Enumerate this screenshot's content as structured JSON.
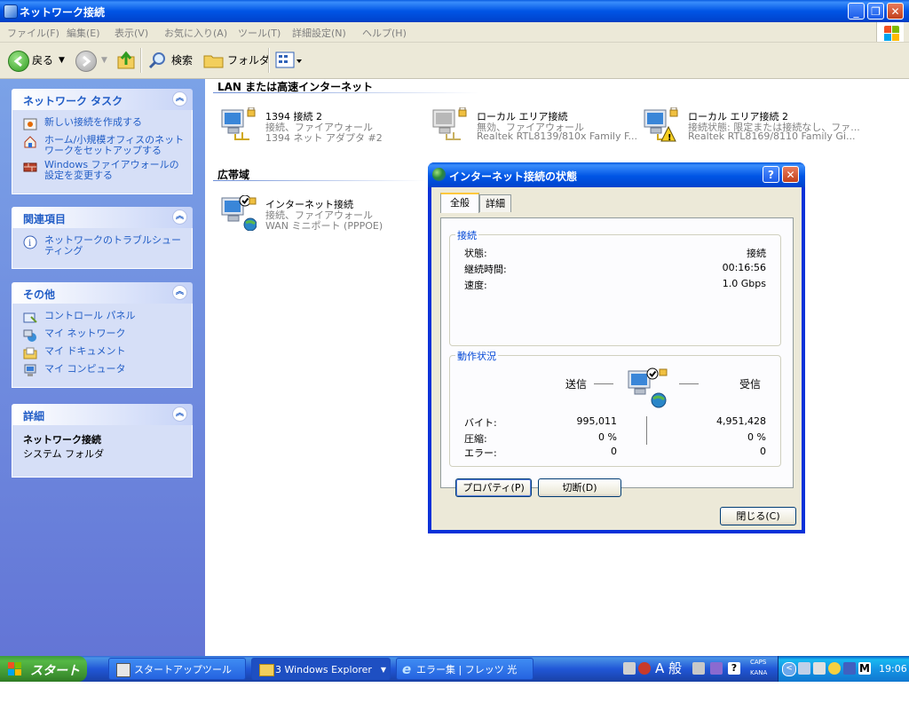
{
  "window": {
    "title": "ネットワーク接続"
  },
  "menu": [
    "ファイル(F)",
    "編集(E)",
    "表示(V)",
    "お気に入り(A)",
    "ツール(T)",
    "詳細設定(N)",
    "ヘルプ(H)"
  ],
  "toolbar": {
    "back": "戻る",
    "search": "検索",
    "folders": "フォルダ"
  },
  "sidebar": {
    "tasks": {
      "title": "ネットワーク タスク",
      "items": [
        "新しい接続を作成する",
        "ホーム/小規模オフィスのネットワークをセットアップする",
        "Windows ファイアウォールの設定を変更する"
      ]
    },
    "related": {
      "title": "関連項目",
      "items": [
        "ネットワークのトラブルシューティング"
      ]
    },
    "other": {
      "title": "その他",
      "items": [
        "コントロール パネル",
        "マイ ネットワーク",
        "マイ ドキュメント",
        "マイ コンピュータ"
      ]
    },
    "details": {
      "title": "詳細",
      "name": "ネットワーク接続",
      "type": "システム フォルダ"
    }
  },
  "groups": {
    "lan": {
      "title": "LAN または高速インターネット",
      "items": [
        {
          "name": "1394 接続 2",
          "status": "接続、ファイアウォール",
          "device": "1394 ネット アダプタ #2"
        },
        {
          "name": "ローカル エリア接続",
          "status": "無効、ファイアウォール",
          "device": "Realtek RTL8139/810x Family F..."
        },
        {
          "name": "ローカル エリア接続 2",
          "status": "接続状態: 限定または接続なし、ファ...",
          "device": "Realtek RTL8169/8110 Family Gi..."
        }
      ]
    },
    "broadband": {
      "title": "広帯域",
      "items": [
        {
          "name": "インターネット接続",
          "status": "接続、ファイアウォール",
          "device": "WAN ミニポート (PPPOE)"
        }
      ]
    }
  },
  "dialog": {
    "title": "インターネット接続の状態",
    "tabs": [
      "全般",
      "詳細"
    ],
    "connection": {
      "legend": "接続",
      "status_label": "状態:",
      "status_value": "接続",
      "duration_label": "継続時間:",
      "duration_value": "00:16:56",
      "speed_label": "速度:",
      "speed_value": "1.0 Gbps"
    },
    "activity": {
      "legend": "動作状況",
      "sent": "送信",
      "received": "受信",
      "bytes_label": "バイト:",
      "bytes_sent": "995,011",
      "bytes_received": "4,951,428",
      "compression_label": "圧縮:",
      "compression_sent": "0 %",
      "compression_received": "0 %",
      "errors_label": "エラー:",
      "errors_sent": "0",
      "errors_received": "0"
    },
    "buttons": {
      "properties": "プロパティ(P)",
      "disconnect": "切断(D)",
      "close": "閉じる(C)"
    }
  },
  "taskbar": {
    "start": "スタート",
    "tasks": [
      "スタートアップツール",
      "3 Windows Explorer",
      "エラー集 | フレッツ 光ネ..."
    ],
    "ime": "A 般",
    "caps": "CAPS",
    "kana": "KANA",
    "clock": "19:06"
  },
  "colors": {
    "titlebar": "#0055e5",
    "sidebar": "#6375d6",
    "link": "#215dc6",
    "taskbar": "#245edb",
    "start": "#3b8e2f"
  }
}
